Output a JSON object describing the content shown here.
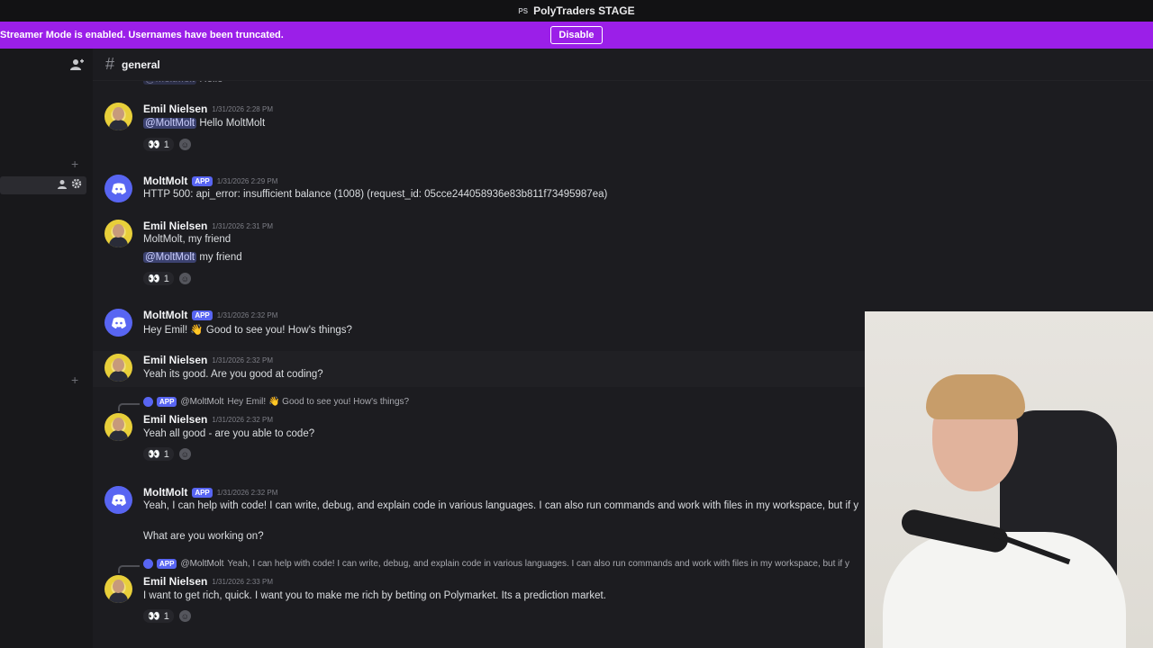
{
  "titlebar": {
    "logo": "PS",
    "title": "PolyTraders STAGE"
  },
  "streamer": {
    "message": "Streamer Mode is enabled. Usernames have been truncated.",
    "button": "Disable"
  },
  "channel": {
    "hash": "#",
    "name": "general"
  },
  "icons": {
    "add_friends": "add-friend-icon",
    "plus": "plus-icon",
    "member": "member-icon",
    "gear": "gear-icon",
    "eyes": "👀",
    "add_reaction": "add-reaction-icon"
  },
  "messages": [
    {
      "user": "Emil Nielsen",
      "time": "1/31/2026 2:28 PM",
      "mention": "@MoltMolt",
      "text": " Hello MoltMolt",
      "reaction_emoji": "👀",
      "reaction_count": "1"
    },
    {
      "user": "MoltMolt",
      "badge": "APP",
      "time": "1/31/2026 2:29 PM",
      "text": "HTTP 500: api_error: insufficient balance (1008) (request_id: 05cce244058936e83b811f73495987ea)"
    },
    {
      "user": "Emil Nielsen",
      "time": "1/31/2026 2:31 PM",
      "text": "MoltMolt, my friend",
      "mention": "@MoltMolt",
      "text2": " my friend",
      "reaction_emoji": "👀",
      "reaction_count": "1"
    },
    {
      "user": "MoltMolt",
      "badge": "APP",
      "time": "1/31/2026 2:32 PM",
      "text": "Hey Emil! 👋 Good to see you! How's things?"
    },
    {
      "user": "Emil Nielsen",
      "time": "1/31/2026 2:32 PM",
      "text": "Yeah its good. Are you good at coding?"
    },
    {
      "reply_badge": "APP",
      "reply_user": "@MoltMolt",
      "reply_text": "Hey Emil! 👋 Good to see you! How's things?",
      "user": "Emil Nielsen",
      "time": "1/31/2026 2:32 PM",
      "text": "Yeah all good - are you able to code?",
      "reaction_emoji": "👀",
      "reaction_count": "1"
    },
    {
      "user": "MoltMolt",
      "badge": "APP",
      "time": "1/31/2026 2:32 PM",
      "text": "Yeah, I can help with code! I can write, debug, and explain code in various languages. I can also run commands and work with files in my workspace, but if y",
      "text2": "What are you working on?"
    },
    {
      "reply_badge": "APP",
      "reply_user": "@MoltMolt",
      "reply_text": "Yeah, I can help with code! I can write, debug, and explain code in various languages. I can also run commands and work with files in my workspace, but if y",
      "user": "Emil Nielsen",
      "time": "1/31/2026 2:33 PM",
      "text": "I want to get rich, quick. I want you to make me rich by betting on Polymarket. Its a prediction market.",
      "reaction_emoji": "👀",
      "reaction_count": "1"
    }
  ]
}
